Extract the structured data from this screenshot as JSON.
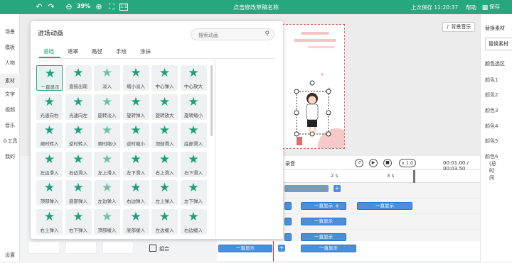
{
  "topbar": {
    "title": "点击修改草稿名称",
    "zoom": "39%",
    "last_saved": "上次保存 11:20:37",
    "help": "帮助",
    "save": "保存"
  },
  "left_nav": {
    "items": [
      "场景",
      "模板",
      "人物",
      "素材",
      "文字",
      "视频",
      "音乐",
      "小工具",
      "我的"
    ],
    "settings": "设置"
  },
  "canvas": {
    "bgm_button": "背景音乐"
  },
  "right_panel": {
    "replace_title": "替换素材",
    "replace_button": "替换素材",
    "color_title": "颜色选区",
    "colors": [
      "颜色1",
      "颜色2",
      "颜色3",
      "颜色4",
      "颜色5",
      "颜色6"
    ]
  },
  "timeline": {
    "record_label": "录音",
    "speed": "x 1.0",
    "time": "00:01.00 / 00:03.50",
    "time_suffix": "(总时间",
    "ticks": [
      "2 s",
      "3 s"
    ],
    "segment_label": "一直显示",
    "group_label": "组合"
  },
  "modal": {
    "title": "进场动画",
    "search_placeholder": "搜索动画",
    "tabs": [
      "基础",
      "遮罩",
      "路径",
      "手绘",
      "涂抹"
    ],
    "items": [
      "一直显示",
      "直接出现",
      "淡入",
      "缩小淡入",
      "中心弹入",
      "中心放大",
      "光速向右",
      "光速向左",
      "旋转淡入",
      "旋转弹入",
      "旋转放大",
      "旋转缩小",
      "顺时转入",
      "逆时转入",
      "顺时缩小",
      "逆时缩小",
      "顶部滑入",
      "底部滑入",
      "左边滑入",
      "右边滑入",
      "左上滑入",
      "左下滑入",
      "右上滑入",
      "右下滑入",
      "顶部弹入",
      "底部弹入",
      "左边弹入",
      "右边弹入",
      "左上弹入",
      "左下弹入",
      "右上弹入",
      "右下弹入",
      "顶部缓入",
      "底部缓入",
      "左边缓入",
      "右边缓入"
    ]
  }
}
